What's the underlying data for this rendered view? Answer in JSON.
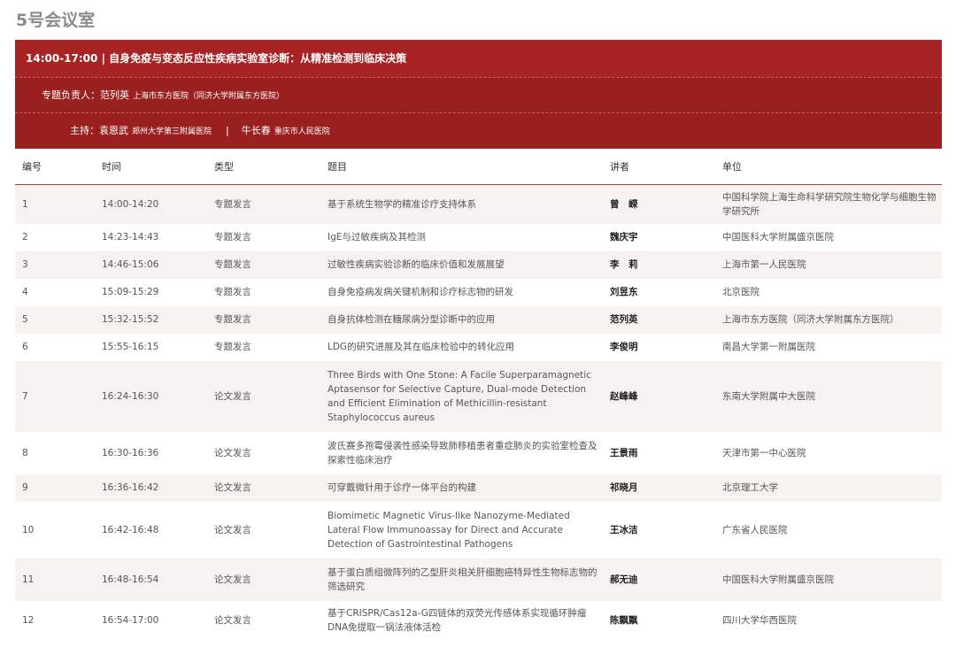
{
  "room": "5号会议室",
  "session": {
    "time": "14:00-17:00",
    "title": "自身免疫与变态反应性疾病实验室诊断：从精准检测到临床决策",
    "leader_label": "专题负责人：",
    "leader_name": "范列英",
    "leader_org": "上海市东方医院（同济大学附属东方医院）",
    "host_label": "主持：",
    "host1_name": "袁恩武",
    "host1_org": "郑州大学第三附属医院",
    "host_sep": "|",
    "host2_name": "牛长春",
    "host2_org": "重庆市人民医院"
  },
  "table": {
    "headers": [
      "编号",
      "时间",
      "类型",
      "题目",
      "讲者",
      "单位"
    ],
    "rows": [
      {
        "no": "1",
        "time": "14:00-14:20",
        "type": "专题发言",
        "title": "基于系统生物学的精准诊疗支持体系",
        "speaker": "曾　嵘",
        "org": "中国科学院上海生命科学研究院生物化学与细胞生物学研究所"
      },
      {
        "no": "2",
        "time": "14:23-14:43",
        "type": "专题发言",
        "title": "IgE与过敏疾病及其检测",
        "speaker": "魏庆宇",
        "org": "中国医科大学附属盛京医院"
      },
      {
        "no": "3",
        "time": "14:46-15:06",
        "type": "专题发言",
        "title": "过敏性疾病实验诊断的临床价值和发展展望",
        "speaker": "李　莉",
        "org": "上海市第一人民医院"
      },
      {
        "no": "4",
        "time": "15:09-15:29",
        "type": "专题发言",
        "title": "自身免疫病发病关键机制和诊疗标志物的研发",
        "speaker": "刘昱东",
        "org": "北京医院"
      },
      {
        "no": "5",
        "time": "15:32-15:52",
        "type": "专题发言",
        "title": "自身抗体检测在糖尿病分型诊断中的应用",
        "speaker": "范列英",
        "org": "上海市东方医院（同济大学附属东方医院）"
      },
      {
        "no": "6",
        "time": "15:55-16:15",
        "type": "专题发言",
        "title": "LDG的研究进展及其在临床检验中的转化应用",
        "speaker": "李俊明",
        "org": "南昌大学第一附属医院"
      },
      {
        "no": "7",
        "time": "16:24-16:30",
        "type": "论文发言",
        "title": "Three Birds with One Stone: A Facile Superparamagnetic Aptasensor for Selective Capture, Dual-mode Detection and Efficient Elimination of Methicillin-resistant Staphylococcus aureus",
        "speaker": "赵峰峰",
        "org": "东南大学附属中大医院"
      },
      {
        "no": "8",
        "time": "16:30-16:36",
        "type": "论文发言",
        "title": "波氏赛多孢霉侵袭性感染导致肺移植患者重症肺炎的实验室检查及探索性临床治疗",
        "speaker": "王景雨",
        "org": "天津市第一中心医院"
      },
      {
        "no": "9",
        "time": "16:36-16:42",
        "type": "论文发言",
        "title": "可穿戴微针用于诊疗一体平台的构建",
        "speaker": "祁晓月",
        "org": "北京理工大学"
      },
      {
        "no": "10",
        "time": "16:42-16:48",
        "type": "论文发言",
        "title": "Biomimetic Magnetic Virus-like Nanozyme-Mediated Lateral Flow Immunoassay for Direct and Accurate Detection of Gastrointestinal Pathogens",
        "speaker": "王冰洁",
        "org": "广东省人民医院"
      },
      {
        "no": "11",
        "time": "16:48-16:54",
        "type": "论文发言",
        "title": "基于蛋白质组微阵列的乙型肝炎相关肝细胞癌特异性生物标志物的筛选研究",
        "speaker": "郝无迪",
        "org": "中国医科大学附属盛京医院"
      },
      {
        "no": "12",
        "time": "16:54-17:00",
        "type": "论文发言",
        "title": "基于CRISPR/Cas12a-G四链体的双荧光传感体系实现循环肿瘤DNA免提取一锅法液体活检",
        "speaker": "陈飘飘",
        "org": "四川大学华西医院"
      }
    ]
  }
}
